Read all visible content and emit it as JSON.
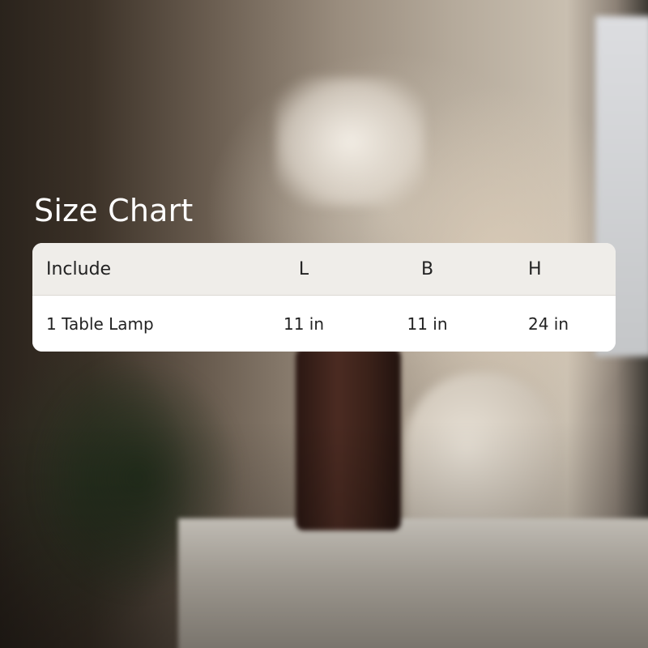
{
  "title": "Size Chart",
  "table": {
    "headers": [
      "Include",
      "L",
      "B",
      "H"
    ],
    "rows": [
      [
        "1 Table Lamp",
        "11 in",
        "11 in",
        "24 in"
      ]
    ]
  },
  "colors": {
    "title_text": "#ffffff",
    "header_bg": "#efede9",
    "body_bg": "#ffffff",
    "text": "#222222"
  }
}
